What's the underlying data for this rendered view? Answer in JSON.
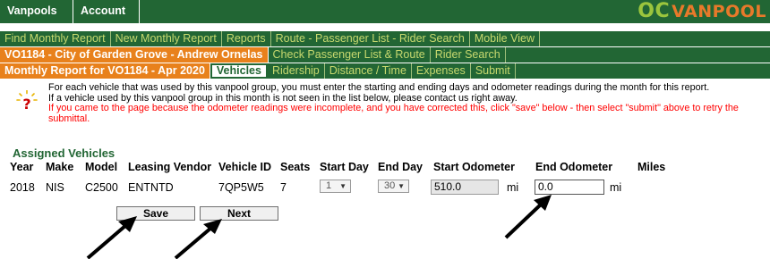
{
  "topbar": {
    "menus": [
      "Vanpools ▼",
      "Account ▼"
    ],
    "logo_oc": "OC",
    "logo_vanpool": "VANPOOL"
  },
  "nav": {
    "row1": [
      "Find Monthly Report",
      "New Monthly Report",
      "Reports",
      "Route - Passenger List - Rider Search",
      "Mobile View"
    ],
    "row2_orange": "VO1184 - City of Garden Grove - Andrew Ornelas",
    "row2": [
      "Check Passenger List & Route",
      "Rider Search"
    ],
    "row3_orange": "Monthly Report for VO1184 - Apr 2020",
    "row3_active": "Vehicles",
    "row3": [
      "Ridership",
      "Distance / Time",
      "Expenses",
      "Submit"
    ]
  },
  "info": {
    "line1": "For each vehicle that was used by this vanpool group, you must enter the starting and ending days and odometer readings during the month for this report.",
    "line2": "If a vehicle used by this vanpool group in this month is not seen in the list below, please contact us right away.",
    "line3": "If you came to the page because the odometer readings were incomplete, and you have corrected this, click \"save\" below - then select \"submit\" above to retry the submittal."
  },
  "section_title": "Assigned Vehicles",
  "table": {
    "headers": [
      "Year",
      "Make",
      "Model",
      "Leasing Vendor",
      "Vehicle ID",
      "Seats",
      "Start Day",
      "End Day",
      "Start Odometer",
      "End Odometer",
      "Miles"
    ],
    "row": {
      "year": "2018",
      "make": "NIS",
      "model": "C2500",
      "vendor": "ENTNTD",
      "vehicle_id": "7QP5W5",
      "seats": "7",
      "start_day": "1",
      "end_day": "30",
      "start_odometer": "510.0",
      "end_odometer": "0.0",
      "unit": "mi",
      "miles": ""
    }
  },
  "buttons": {
    "save": "Save",
    "next": "Next"
  },
  "colors": {
    "nav_green": "#226634",
    "accent_orange": "#e8811c",
    "link_yellowgreen": "#c8d96f",
    "warning_red": "#ff0000"
  }
}
